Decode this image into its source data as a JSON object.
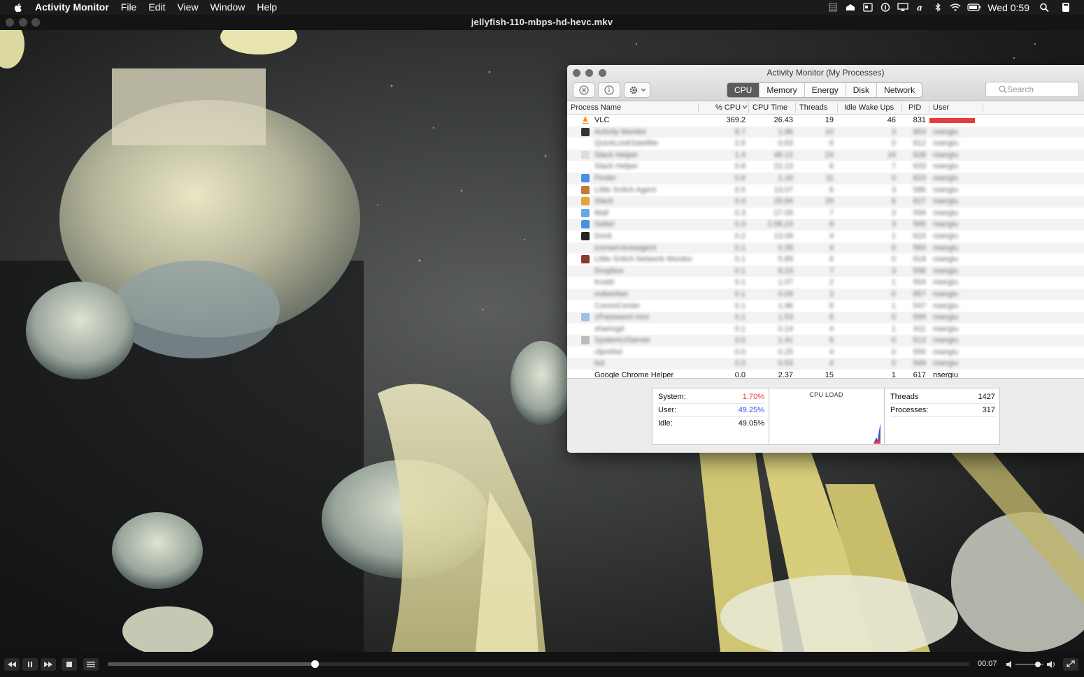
{
  "menubar": {
    "app_name": "Activity Monitor",
    "items": [
      "File",
      "Edit",
      "View",
      "Window",
      "Help"
    ],
    "clock": "Wed 0:59"
  },
  "vlc": {
    "title": "jellyfish-110-mbps-hd-hevc.mkv",
    "elapsed": "00:07",
    "progress_fraction": 0.24,
    "volume_fraction": 0.8
  },
  "activity_monitor": {
    "title": "Activity Monitor (My Processes)",
    "tabs": [
      "CPU",
      "Memory",
      "Energy",
      "Disk",
      "Network"
    ],
    "active_tab": "CPU",
    "search_placeholder": "Search",
    "columns": [
      "Process Name",
      "% CPU",
      "CPU Time",
      "Threads",
      "Idle Wake Ups",
      "PID",
      "User"
    ],
    "rows": [
      {
        "name": "VLC",
        "cpu": "369.2",
        "time": "26.43",
        "threads": "19",
        "wakeups": "46",
        "pid": "831",
        "user": "",
        "icon_color": "#f58a1f"
      },
      {
        "name": "Activity Monitor",
        "cpu": "8.7",
        "time": "1.86",
        "threads": "10",
        "wakeups": "3",
        "pid": "853",
        "user": "nsergiu",
        "icon_color": "#333333"
      },
      {
        "name": "QuickLookSatellite",
        "cpu": "2.6",
        "time": "0.63",
        "threads": "6",
        "wakeups": "0",
        "pid": "812",
        "user": "nsergiu",
        "icon_color": ""
      },
      {
        "name": "Slack Helper",
        "cpu": "1.4",
        "time": "48.12",
        "threads": "24",
        "wakeups": "16",
        "pid": "628",
        "user": "nsergiu",
        "icon_color": "#dddddd"
      },
      {
        "name": "Slack Helper",
        "cpu": "0.8",
        "time": "22.13",
        "threads": "6",
        "wakeups": "7",
        "pid": "633",
        "user": "nsergiu",
        "icon_color": ""
      },
      {
        "name": "Finder",
        "cpu": "0.6",
        "time": "1.16",
        "threads": "11",
        "wakeups": "0",
        "pid": "623",
        "user": "nsergiu",
        "icon_color": "#4a90e2"
      },
      {
        "name": "Little Snitch Agent",
        "cpu": "0.5",
        "time": "13.07",
        "threads": "6",
        "wakeups": "3",
        "pid": "586",
        "user": "nsergiu",
        "icon_color": "#c07a3a"
      },
      {
        "name": "Slack",
        "cpu": "0.4",
        "time": "29.84",
        "threads": "29",
        "wakeups": "6",
        "pid": "627",
        "user": "nsergiu",
        "icon_color": "#e8a23b"
      },
      {
        "name": "Mail",
        "cpu": "0.3",
        "time": "27.09",
        "threads": "7",
        "wakeups": "3",
        "pid": "594",
        "user": "nsergiu",
        "icon_color": "#6aa9e8"
      },
      {
        "name": "Safari",
        "cpu": "0.3",
        "time": "1:08.23",
        "threads": "8",
        "wakeups": "3",
        "pid": "595",
        "user": "nsergiu",
        "icon_color": "#4a90e2"
      },
      {
        "name": "Dock",
        "cpu": "0.2",
        "time": "13.09",
        "threads": "4",
        "wakeups": "1",
        "pid": "615",
        "user": "nsergiu",
        "icon_color": "#222222"
      },
      {
        "name": "iconservicesagent",
        "cpu": "0.1",
        "time": "0.39",
        "threads": "4",
        "wakeups": "0",
        "pid": "583",
        "user": "nsergiu",
        "icon_color": ""
      },
      {
        "name": "Little Snitch Network Monitor",
        "cpu": "0.1",
        "time": "5.89",
        "threads": "6",
        "wakeups": "0",
        "pid": "618",
        "user": "nsergiu",
        "icon_color": "#8b3a2a"
      },
      {
        "name": "Dropbox",
        "cpu": "0.1",
        "time": "8.23",
        "threads": "7",
        "wakeups": "3",
        "pid": "598",
        "user": "nsergiu",
        "icon_color": ""
      },
      {
        "name": "trustd",
        "cpu": "0.1",
        "time": "1.07",
        "threads": "2",
        "wakeups": "1",
        "pid": "554",
        "user": "nsergiu",
        "icon_color": ""
      },
      {
        "name": "mdworker",
        "cpu": "0.1",
        "time": "0.09",
        "threads": "3",
        "wakeups": "0",
        "pid": "857",
        "user": "nsergiu",
        "icon_color": ""
      },
      {
        "name": "CommCenter",
        "cpu": "0.1",
        "time": "1.96",
        "threads": "8",
        "wakeups": "1",
        "pid": "547",
        "user": "nsergiu",
        "icon_color": ""
      },
      {
        "name": "1Password mini",
        "cpu": "0.1",
        "time": "1.53",
        "threads": "6",
        "wakeups": "0",
        "pid": "599",
        "user": "nsergiu",
        "icon_color": "#9fbfe8"
      },
      {
        "name": "sharingd",
        "cpu": "0.1",
        "time": "0.14",
        "threads": "4",
        "wakeups": "1",
        "pid": "611",
        "user": "nsergiu",
        "icon_color": ""
      },
      {
        "name": "SystemUIServer",
        "cpu": "0.0",
        "time": "1.41",
        "threads": "6",
        "wakeups": "0",
        "pid": "613",
        "user": "nsergiu",
        "icon_color": "#bbbbbb"
      },
      {
        "name": "cfprefsd",
        "cpu": "0.0",
        "time": "0.25",
        "threads": "4",
        "wakeups": "0",
        "pid": "556",
        "user": "nsergiu",
        "icon_color": ""
      },
      {
        "name": "lsd",
        "cpu": "0.0",
        "time": "0.53",
        "threads": "4",
        "wakeups": "0",
        "pid": "569",
        "user": "nsergiu",
        "icon_color": ""
      },
      {
        "name": "Google Chrome Helper",
        "cpu": "0.0",
        "time": "2.37",
        "threads": "15",
        "wakeups": "1",
        "pid": "617",
        "user": "nsergiu",
        "icon_color": ""
      }
    ],
    "stats": {
      "system_label": "System:",
      "system_value": "1.70%",
      "system_color": "#e23b3b",
      "user_label": "User:",
      "user_value": "49.25%",
      "user_color": "#3b4fe2",
      "idle_label": "Idle:",
      "idle_value": "49.05%",
      "cpu_load_label": "CPU LOAD",
      "threads_label": "Threads",
      "threads_value": "1427",
      "processes_label": "Processes:",
      "processes_value": "317"
    }
  }
}
